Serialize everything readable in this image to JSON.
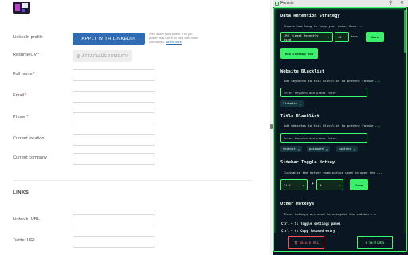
{
  "form": {
    "fields": {
      "linkedin": {
        "label": "LinkedIn profile",
        "button": "APPLY WITH LINKEDIN",
        "note": "We'll share your profile. The job poster may use it for jobs with other companies.",
        "note_link": "Learn more"
      },
      "resume": {
        "label": "Resume/CV",
        "required": "*",
        "button": "ATTACH RESUME/CV",
        "icon": "paperclip-icon"
      },
      "full_name": {
        "label": "Full name",
        "required": "*",
        "value": ""
      },
      "email": {
        "label": "Email",
        "required": "*",
        "value": ""
      },
      "phone": {
        "label": "Phone",
        "required": "*",
        "value": ""
      },
      "location": {
        "label": "Current location",
        "value": ""
      },
      "company": {
        "label": "Current company",
        "value": ""
      }
    },
    "links_section": "LINKS",
    "links": {
      "linkedin_url": {
        "label": "LinkedIn URL",
        "value": ""
      },
      "twitter_url": {
        "label": "Twitter URL",
        "value": ""
      }
    }
  },
  "extension": {
    "window_title": "Formie",
    "pin_icon": "pin-icon",
    "close_icon": "close-icon",
    "retention": {
      "heading": "Data Retention Strategy",
      "desc": "Choose how long to keep your data. Keep",
      "more": "...",
      "strategy": "LRU (Least Recently Used)",
      "days_value": "45",
      "days_label": "days",
      "save": "Save",
      "run_cleanup": "Run Cleanup Now"
    },
    "website_blacklist": {
      "heading": "Website Blacklist",
      "desc": "Add keywords to this blacklist to prevent Formie",
      "more": "...",
      "placeholder": "Enter keyword and press Enter",
      "tags": [
        "linkedin"
      ]
    },
    "title_blacklist": {
      "heading": "Title Blacklist",
      "desc": "Add websites to this blacklist to prevent Formie",
      "more": "...",
      "placeholder": "Enter keyword and press Enter",
      "tags": [
        "receipt",
        "password",
        "captcha"
      ]
    },
    "sidebar_hotkey": {
      "heading": "Sidebar Toggle Hotkey",
      "desc": "Customize the hotkey combination used to open the",
      "more": "...",
      "modifier": "Ctrl",
      "plus": "+",
      "key": "M",
      "save": "Save"
    },
    "other_hotkeys": {
      "heading": "Other Hotkeys",
      "desc": "These hotkeys are used to navigate the sidebar",
      "more": "...",
      "items": [
        "Ctrl + S: Toggle settings panel",
        "Ctrl + C: Copy focused entry"
      ]
    },
    "footer": {
      "delete_all": "DELETE ALL",
      "delete_icon": "trash-icon",
      "settings": "SETTINGS",
      "settings_icon": "gear-icon"
    },
    "colors": {
      "accent": "#39ff6e",
      "panel_bg": "#0a1722",
      "danger": "#ff4d4d"
    }
  }
}
